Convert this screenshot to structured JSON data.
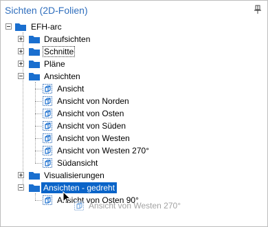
{
  "panel": {
    "title": "Sichten (2D-Folien)",
    "pin_icon": "pin-icon"
  },
  "colors": {
    "title": "#2f6ebd",
    "folder": "#1a6fcf",
    "selection": "#0a64c8"
  },
  "tree": {
    "root": "EFH-arc",
    "folders": {
      "draufsichten": "Draufsichten",
      "schnitte": "Schnitte",
      "plaene": "Pläne",
      "ansichten": "Ansichten",
      "visualisierungen": "Visualisierungen",
      "ansichten_gedreht": "Ansichten - gedreht"
    },
    "ansichten_items": [
      "Ansicht",
      "Ansicht von Norden",
      "Ansicht von Osten",
      "Ansicht von Süden",
      "Ansicht von Westen",
      "Ansicht von Westen 270°",
      "Südansicht"
    ],
    "gedreht_items": [
      "Ansicht von Osten 90°"
    ]
  },
  "drag": {
    "ghost_label": "Ansicht von Westen 270°"
  }
}
